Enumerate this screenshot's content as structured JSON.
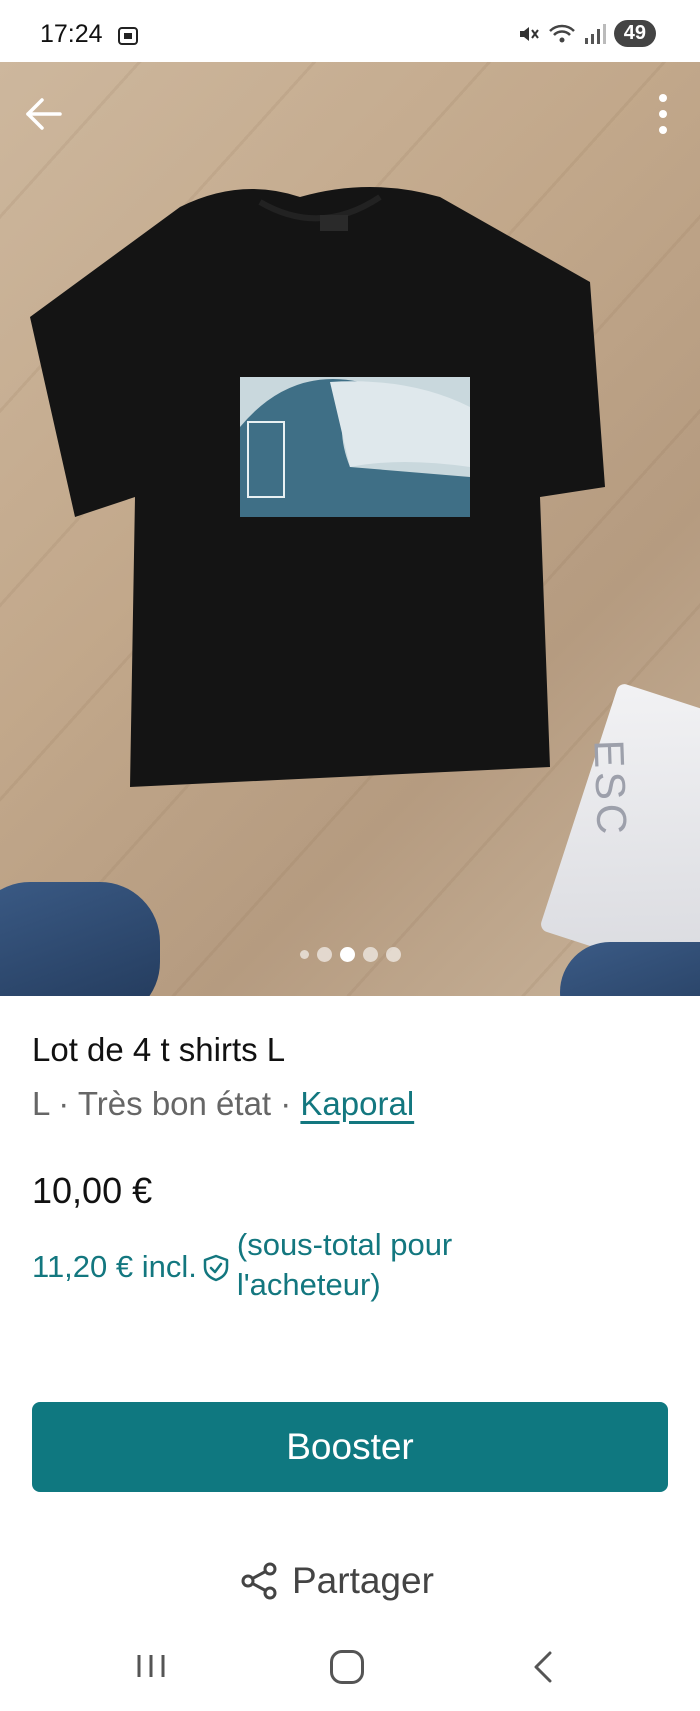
{
  "status_bar": {
    "time": "17:24",
    "battery": "49",
    "icons": [
      "screen-record-icon",
      "mute-icon",
      "wifi-icon",
      "signal-icon"
    ]
  },
  "photo": {
    "bag_text": "ESC",
    "carousel": {
      "count": 5,
      "active_index": 2
    }
  },
  "header": {
    "back_icon": "arrow-left-icon",
    "more_icon": "more-vertical-icon"
  },
  "item": {
    "title": "Lot de 4 t shirts L",
    "size": "L",
    "separator": " · ",
    "condition": "Très bon état",
    "brand": "Kaporal",
    "price": "10,00 €",
    "price_incl": "11,20 € incl.",
    "price_incl_note": "(sous-total pour l'acheteur)"
  },
  "actions": {
    "booster_label": "Booster",
    "share_label": "Partager"
  },
  "colors": {
    "accent": "#0f7880",
    "link": "#13777f"
  }
}
